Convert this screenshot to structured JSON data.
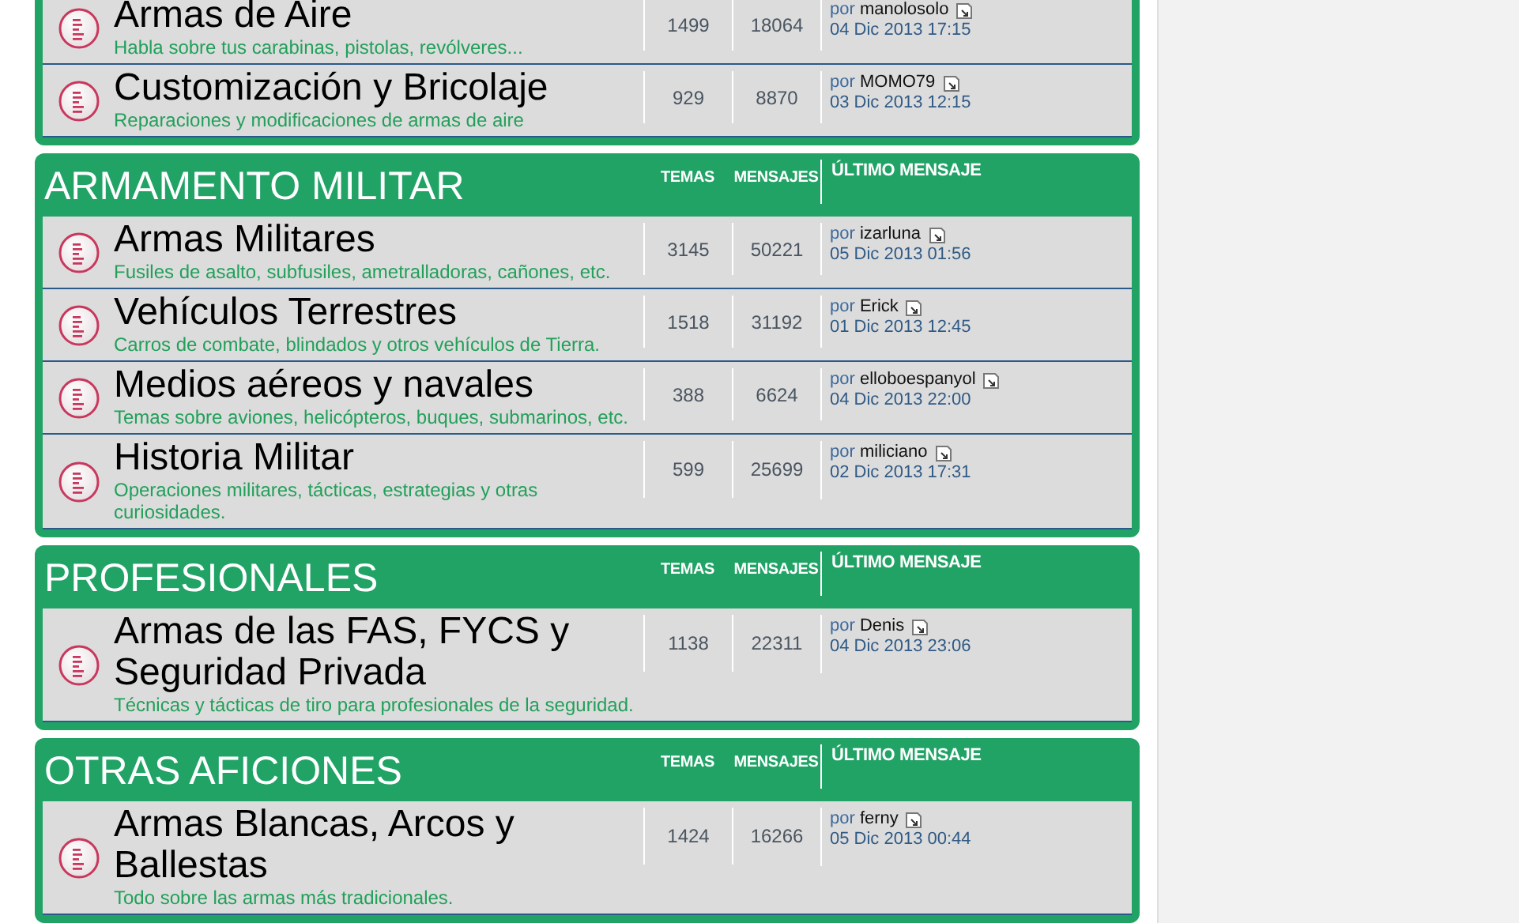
{
  "categories": [
    {
      "rows": [
        {
          "title": "Armas de Aire",
          "description": "Habla sobre tus carabinas, pistolas, revólveres...",
          "topics": "1499",
          "posts": "18064",
          "last_post": {
            "prefix": "por",
            "author": "manolosolo",
            "date": "04 Dic 2013 17:15"
          }
        },
        {
          "title": "Customización y Bricolaje",
          "description": "Reparaciones y modificaciones de armas de aire",
          "topics": "929",
          "posts": "8870",
          "last_post": {
            "prefix": "por",
            "author": "MOMO79",
            "date": "03 Dic 2013 12:15"
          }
        }
      ]
    },
    {
      "title": "ARMAMENTO MILITAR",
      "column_headers": [
        "TEMAS",
        "MENSAJES",
        "ÚLTIMO MENSAJE"
      ],
      "rows": [
        {
          "title": "Armas Militares",
          "description": "Fusiles de asalto, subfusiles, ametralladoras, cañones, etc.",
          "topics": "3145",
          "posts": "50221",
          "last_post": {
            "prefix": "por",
            "author": "izarluna",
            "date": "05 Dic 2013 01:56"
          }
        },
        {
          "title": "Vehículos Terrestres",
          "description": "Carros de combate, blindados y otros vehículos de Tierra.",
          "topics": "1518",
          "posts": "31192",
          "last_post": {
            "prefix": "por",
            "author": "Erick",
            "date": "01 Dic 2013 12:45"
          }
        },
        {
          "title": "Medios aéreos y navales",
          "description": "Temas sobre aviones, helicópteros, buques, submarinos, etc.",
          "topics": "388",
          "posts": "6624",
          "last_post": {
            "prefix": "por",
            "author": "elloboespanyol",
            "date": "04 Dic 2013 22:00"
          }
        },
        {
          "title": "Historia Militar",
          "description": "Operaciones militares, tácticas, estrategias y otras curiosidades.",
          "topics": "599",
          "posts": "25699",
          "last_post": {
            "prefix": "por",
            "author": "miliciano",
            "date": "02 Dic 2013 17:31"
          }
        }
      ]
    },
    {
      "title": "PROFESIONALES",
      "column_headers": [
        "TEMAS",
        "MENSAJES",
        "ÚLTIMO MENSAJE"
      ],
      "rows": [
        {
          "title": "Armas de las FAS, FYCS y Seguridad Privada",
          "description": "Técnicas y tácticas de tiro para profesionales de la seguridad.",
          "topics": "1138",
          "posts": "22311",
          "last_post": {
            "prefix": "por",
            "author": "Denis",
            "date": "04 Dic 2013 23:06"
          }
        }
      ]
    },
    {
      "title": "OTRAS AFICIONES",
      "column_headers": [
        "TEMAS",
        "MENSAJES",
        "ÚLTIMO MENSAJE"
      ],
      "rows": [
        {
          "title": "Armas Blancas, Arcos y Ballestas",
          "description": "Todo sobre las armas más tradicionales.",
          "topics": "1424",
          "posts": "16266",
          "last_post": {
            "prefix": "por",
            "author": "ferny",
            "date": "05 Dic 2013 00:44"
          }
        }
      ]
    }
  ]
}
